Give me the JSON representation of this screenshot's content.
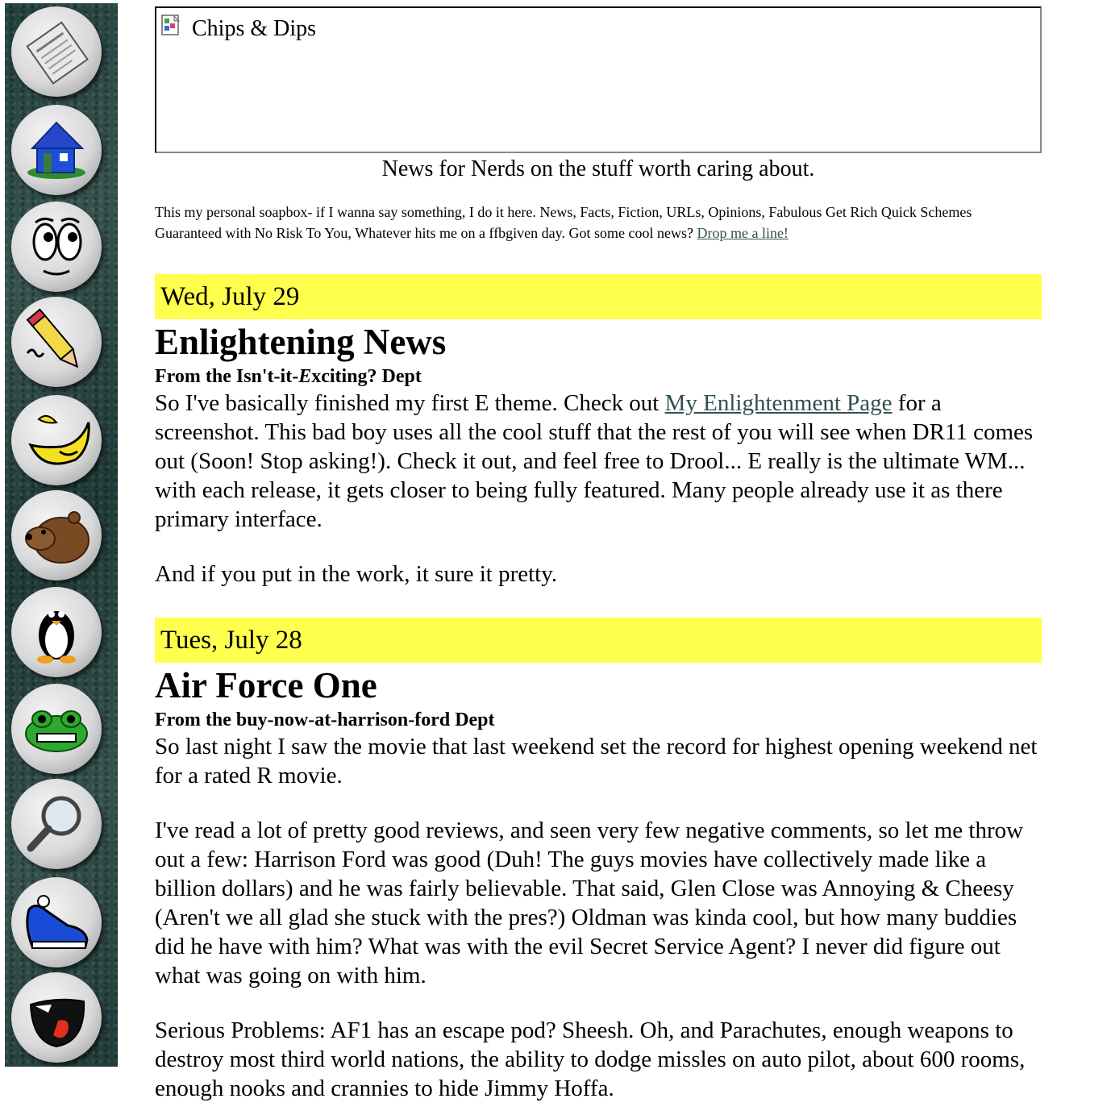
{
  "sidebar": {
    "items": [
      {
        "icon": "newspaper-icon"
      },
      {
        "icon": "home-icon"
      },
      {
        "icon": "eyes-face-icon"
      },
      {
        "icon": "pencil-icon"
      },
      {
        "icon": "banana-icon"
      },
      {
        "icon": "bear-icon"
      },
      {
        "icon": "tux-penguin-icon"
      },
      {
        "icon": "frog-icon"
      },
      {
        "icon": "magnifier-icon"
      },
      {
        "icon": "sneaker-icon"
      },
      {
        "icon": "mouth-icon"
      }
    ]
  },
  "banner": {
    "alt_text": "Chips & Dips",
    "icon": "broken-image-icon"
  },
  "tagline": "News for Nerds on the stuff worth caring about.",
  "intro": {
    "text": "This my personal soapbox- if I wanna say something, I do it here. News, Facts, Fiction, URLs, Opinions, Fabulous Get Rich Quick Schemes Guaranteed with No Risk To You, Whatever hits me on a ffbgiven day. Got some cool news? ",
    "link": "Drop me a line!"
  },
  "colors": {
    "date_bar": "#ffff4d",
    "sidebar": "#2c4a48",
    "link": "#2f4f4f"
  },
  "posts": [
    {
      "date": "Wed, July 29",
      "title": "Enlightening News",
      "dept_before": "From the Isn't-it-",
      "dept_em": "E",
      "dept_after": "xciting? Dept",
      "p1_before": "So I've basically finished my first E theme. Check out ",
      "p1_link": "My Enlightenment Page",
      "p1_after": " for a screenshot. This bad boy uses all the cool stuff that the rest of you will see when DR11 comes out (Soon! Stop asking!). Check it out, and feel free to Drool... E really is the ultimate WM... with each release, it gets closer to being fully featured. Many people already use it as there primary interface.",
      "p2": "And if you put in the work, it sure it pretty."
    },
    {
      "date": "Tues, July 28",
      "title": "Air Force One",
      "dept": "From the buy-now-at-harrison-ford Dept",
      "p1": "So last night I saw the movie that last weekend set the record for highest opening weekend net for a rated R movie.",
      "p2": "I've read a lot of pretty good reviews, and seen very few negative comments, so let me throw out a few: Harrison Ford was good (Duh! The guys movies have collectively made like a billion dollars) and he was fairly believable. That said, Glen Close was Annoying & Cheesy (Aren't we all glad she stuck with the pres?) Oldman was kinda cool, but how many buddies did he have with him? What was with the evil Secret Service Agent? I never did figure out what was going on with him.",
      "p3": "Serious Problems: AF1 has an escape pod? Sheesh. Oh, and Parachutes, enough weapons to destroy most third world nations, the ability to dodge missles on auto pilot, about 600 rooms, enough nooks and crannies to hide Jimmy Hoffa."
    }
  ]
}
